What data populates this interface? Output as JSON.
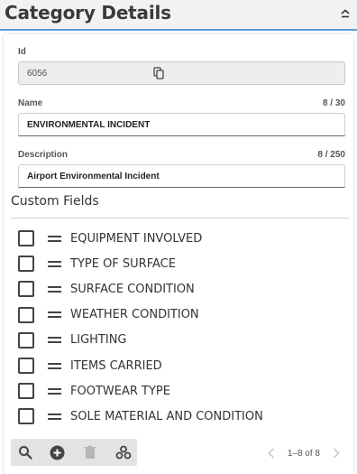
{
  "header": {
    "title": "Category Details",
    "collapse_icon": "chevron-up-icon"
  },
  "form": {
    "id": {
      "label": "Id",
      "value": "6056",
      "copy_icon": "copy-icon"
    },
    "name": {
      "label": "Name",
      "value": "ENVIRONMENTAL INCIDENT",
      "counter": "8 / 30"
    },
    "description": {
      "label": "Description",
      "value": "Airport Environmental Incident",
      "counter": "8 / 250"
    }
  },
  "custom_fields": {
    "title": "Custom Fields",
    "items": [
      {
        "label": "EQUIPMENT INVOLVED",
        "checked": false
      },
      {
        "label": "TYPE OF SURFACE",
        "checked": false
      },
      {
        "label": "SURFACE CONDITION",
        "checked": false
      },
      {
        "label": "WEATHER CONDITION",
        "checked": false
      },
      {
        "label": "LIGHTING",
        "checked": false
      },
      {
        "label": "ITEMS CARRIED",
        "checked": false
      },
      {
        "label": "FOOTWEAR TYPE",
        "checked": false
      },
      {
        "label": "SOLE MATERIAL AND CONDITION",
        "checked": false
      }
    ]
  },
  "toolbar": {
    "buttons": [
      "search-icon",
      "add-circle-icon",
      "trash-icon",
      "settings-icon"
    ]
  },
  "pagination": {
    "text": "1–8 of 8",
    "prev_icon": "chevron-left-icon",
    "next_icon": "chevron-right-icon"
  },
  "colors": {
    "accent_line": "#5b9bd5",
    "header_bg": "#f2f2f2",
    "toolbar_bg": "#e3e3e3"
  }
}
